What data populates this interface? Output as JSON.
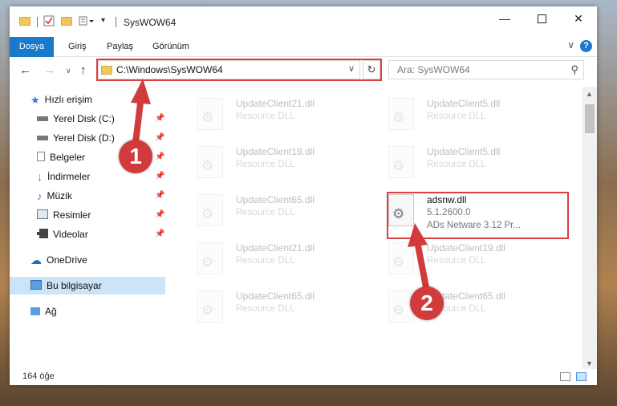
{
  "window": {
    "title": "SysWOW64"
  },
  "ribbon": {
    "tabs": [
      "Dosya",
      "Giriş",
      "Paylaş",
      "Görünüm"
    ],
    "help": "?"
  },
  "nav": {
    "address": "C:\\Windows\\SysWOW64",
    "search_placeholder": "Ara: SysWOW64"
  },
  "sidebar": {
    "items": [
      {
        "label": "Hızlı erişim",
        "icon": "star-icon"
      },
      {
        "label": "Yerel Disk (C:)",
        "icon": "drive-icon"
      },
      {
        "label": "Yerel Disk (D:)",
        "icon": "drive-icon"
      },
      {
        "label": "Belgeler",
        "icon": "documents-icon"
      },
      {
        "label": "İndirmeler",
        "icon": "download-icon"
      },
      {
        "label": "Müzik",
        "icon": "music-icon"
      },
      {
        "label": "Resimler",
        "icon": "pictures-icon"
      },
      {
        "label": "Videolar",
        "icon": "video-icon"
      },
      {
        "label": "OneDrive",
        "icon": "cloud-icon"
      },
      {
        "label": "Bu bilgisayar",
        "icon": "computer-icon"
      },
      {
        "label": "Ağ",
        "icon": "network-icon"
      }
    ]
  },
  "files": [
    {
      "name": "UpdateClient21.dll",
      "desc": "Resource DLL"
    },
    {
      "name": "UpdateClient5.dll",
      "desc": "Resource DLL"
    },
    {
      "name": "UpdateClient19.dll",
      "desc": "Resource DLL"
    },
    {
      "name": "UpdateClient5.dll",
      "desc": "Resource DLL"
    },
    {
      "name": "UpdateClient65.dll",
      "desc": "Resource DLL"
    },
    {
      "name": "adsnw.dll",
      "version": "5.1.2600.0",
      "desc": "ADs Netware 3.12 Pr..."
    },
    {
      "name": "UpdateClient21.dll",
      "desc": "Resource DLL"
    },
    {
      "name": "UpdateClient19.dll",
      "desc": "Resource DLL"
    },
    {
      "name": "UpdateClient65.dll",
      "desc": "Resource DLL"
    },
    {
      "name": "UpdateClient65.dll",
      "desc": "Resource DLL"
    }
  ],
  "status": {
    "count": "164 öğe"
  },
  "annotations": {
    "badge1": "1",
    "badge2": "2"
  },
  "colors": {
    "accent": "#1979ca",
    "highlight": "#d94040",
    "selection": "#cce4f7"
  }
}
